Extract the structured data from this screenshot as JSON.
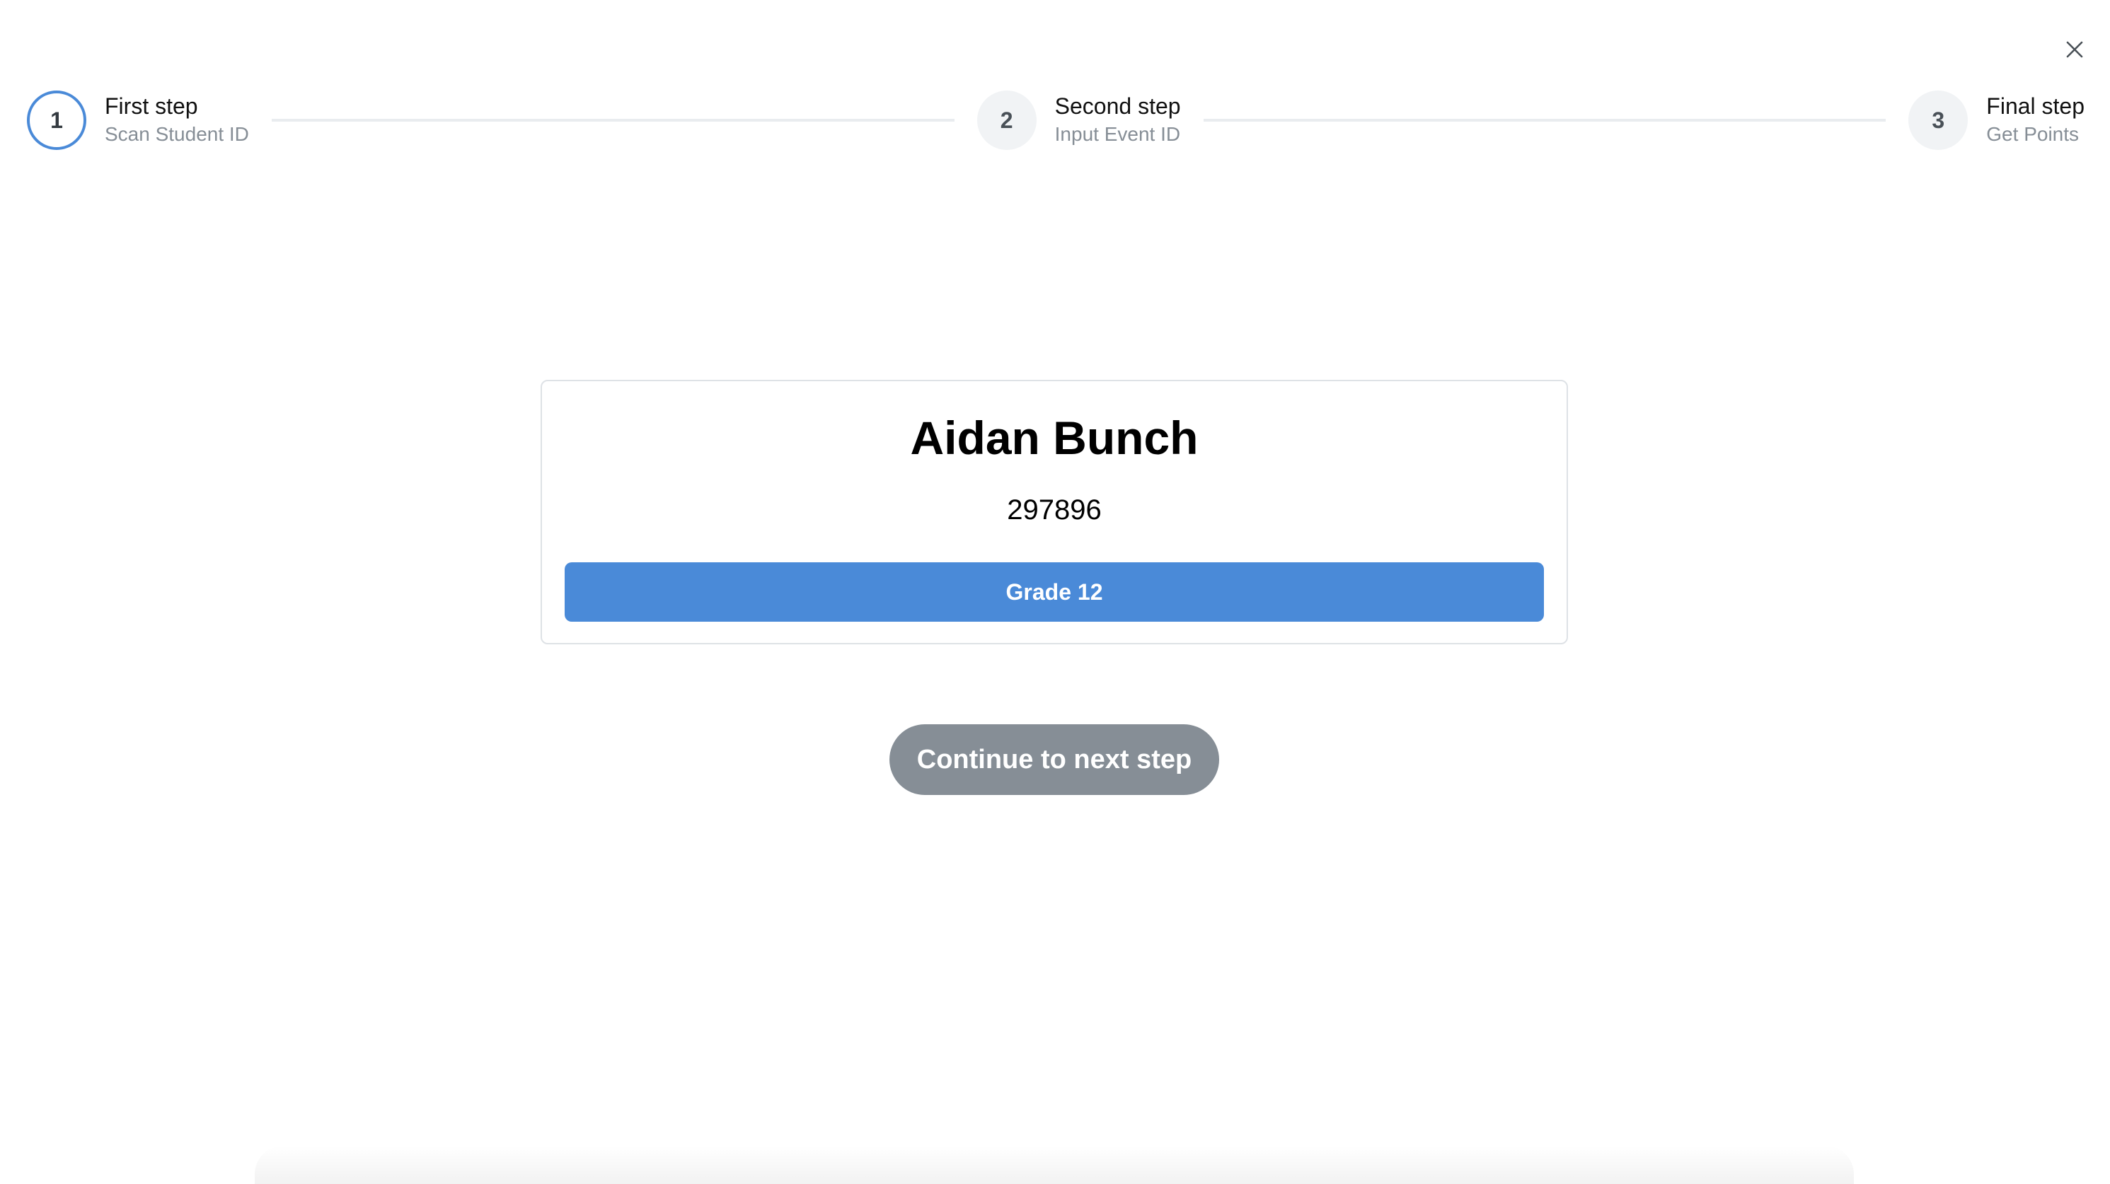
{
  "stepper": {
    "steps": [
      {
        "number": "1",
        "title": "First step",
        "description": "Scan Student ID",
        "state": "active"
      },
      {
        "number": "2",
        "title": "Second step",
        "description": "Input Event ID",
        "state": "inactive"
      },
      {
        "number": "3",
        "title": "Final step",
        "description": "Get Points",
        "state": "inactive"
      }
    ]
  },
  "student": {
    "name": "Aidan Bunch",
    "id": "297896",
    "grade_label": "Grade 12"
  },
  "actions": {
    "continue_label": "Continue to next step"
  },
  "icons": {
    "close": "close-icon"
  },
  "colors": {
    "accent": "#4a8ad8",
    "continue_button": "#868e96",
    "step_inactive_bg": "#f1f3f5"
  }
}
